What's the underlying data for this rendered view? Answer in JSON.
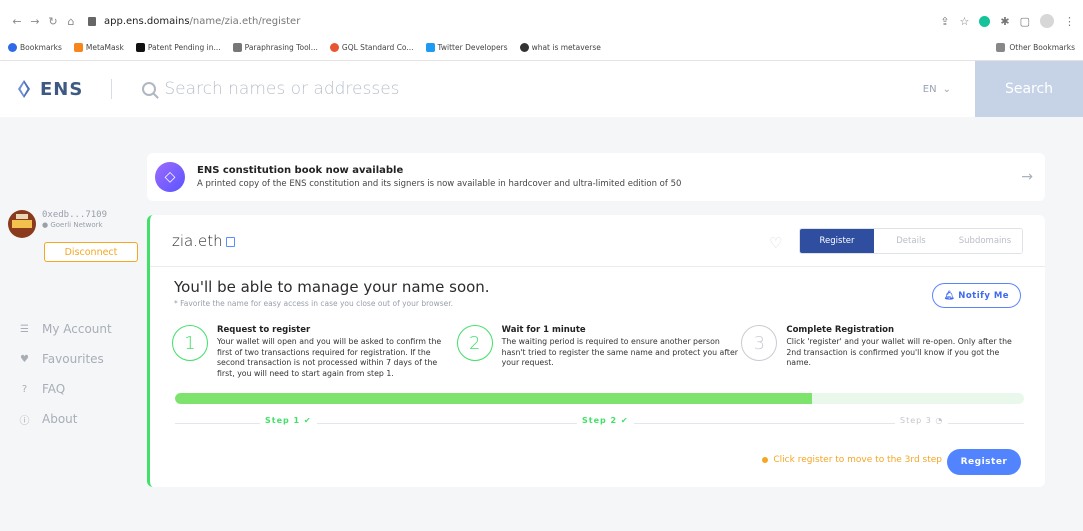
{
  "browser": {
    "url_host": "app.ens.domains",
    "url_path": "/name/zia.eth/register",
    "bookmarks": [
      {
        "label": "Bookmarks",
        "color": "#2f6ae6"
      },
      {
        "label": "MetaMask",
        "color": "#f6851b"
      },
      {
        "label": "Patent Pending in...",
        "color": "#111111"
      },
      {
        "label": "Paraphrasing Tool...",
        "color": "#777777"
      },
      {
        "label": "GQL Standard Co...",
        "color": "#e8552f"
      },
      {
        "label": "Twitter Developers",
        "color": "#1d9bf0"
      },
      {
        "label": "what is metaverse",
        "color": "#333333"
      }
    ],
    "other_bookmarks": "Other Bookmarks"
  },
  "header": {
    "logo_text": "ENS",
    "search_placeholder": "Search names or addresses",
    "lang": "EN",
    "search_button": "Search"
  },
  "sidebar": {
    "address": "0xedb...7109",
    "network": "Goerli Network",
    "disconnect": "Disconnect",
    "menu": [
      {
        "label": "My Account",
        "icon": "list-icon"
      },
      {
        "label": "Favourites",
        "icon": "heart-icon"
      },
      {
        "label": "FAQ",
        "icon": "question-icon"
      },
      {
        "label": "About",
        "icon": "info-icon"
      }
    ]
  },
  "banner": {
    "title": "ENS constitution book now available",
    "text": "A printed copy of the ENS constitution and its signers is now available in hardcover and ultra-limited edition of 50"
  },
  "card": {
    "domain": "zia.eth",
    "tabs": [
      "Register",
      "Details",
      "Subdomains"
    ],
    "active_tab": "Register",
    "manage_title": "You'll be able to manage your name soon.",
    "manage_sub": "* Favorite the name for easy access in case you close out of your browser.",
    "notify": "Notify Me",
    "steps": [
      {
        "num": "1",
        "title": "Request to register",
        "text": "Your wallet will open and you will be asked to confirm the first of two transactions required for registration. If the second transaction is not processed within 7 days of the first, you will need to start again from step 1."
      },
      {
        "num": "2",
        "title": "Wait for 1 minute",
        "text": "The waiting period is required to ensure another person hasn't tried to register the same name and protect you after your request."
      },
      {
        "num": "3",
        "title": "Complete Registration",
        "text": "Click 'register' and your wallet will re-open. Only after the 2nd transaction is confirmed you'll know if you got the name."
      }
    ],
    "progress_percent": 75,
    "step_labels": [
      "Step 1",
      "Step 2",
      "Step 3"
    ],
    "hint": "Click register to move to the 3rd step",
    "register": "Register"
  },
  "colors": {
    "accent_blue": "#2f4ea0",
    "green": "#42e068",
    "orange": "#f5a623",
    "button_blue": "#5284ff"
  }
}
